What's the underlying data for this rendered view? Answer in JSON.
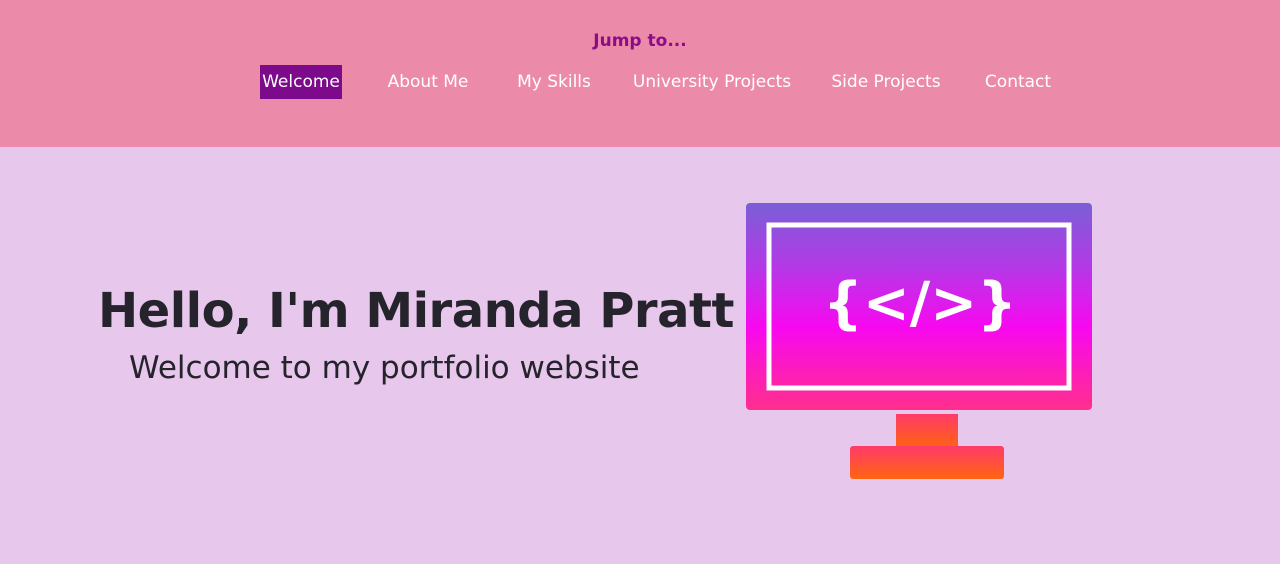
{
  "nav": {
    "heading": "Jump to...",
    "links": [
      {
        "label": "Welcome",
        "active": true
      },
      {
        "label": "About Me",
        "active": false
      },
      {
        "label": "My Skills",
        "active": false
      },
      {
        "label": "University Projects",
        "active": false
      },
      {
        "label": "Side Projects",
        "active": false
      },
      {
        "label": "Contact",
        "active": false
      }
    ]
  },
  "hero": {
    "title": "Hello, I'm Miranda Pratt",
    "subtitle": "Welcome to my portfolio website",
    "illustration": {
      "icon": "monitor-code-icon",
      "code_symbol": "{</>}"
    }
  },
  "colors": {
    "nav_background": "#ec8aaa",
    "page_background": "#e8c7ec",
    "accent_purple": "#7d0a8a",
    "text_dark": "#25232b"
  }
}
